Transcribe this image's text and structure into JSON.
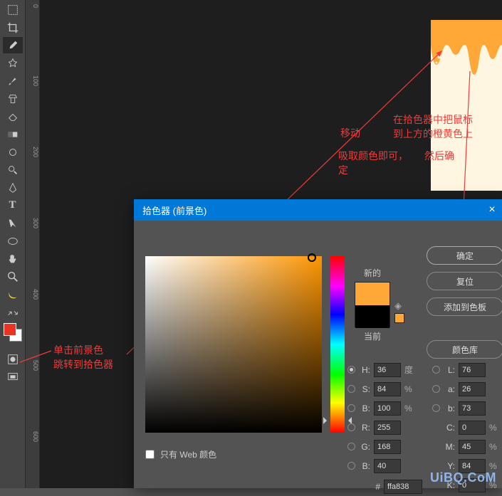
{
  "toolbar_icons": [
    "rect-select",
    "crop",
    "eyedropper",
    "blemish",
    "brush",
    "clone",
    "eraser",
    "paint-bucket",
    "gradient",
    "smudge",
    "dodge",
    "pen",
    "type",
    "path-select",
    "ellipse",
    "hand",
    "zoom",
    "banana"
  ],
  "ruler": {
    "ticks": [
      "0",
      "100",
      "200",
      "300",
      "400",
      "500",
      "600"
    ]
  },
  "annotations": {
    "move": "移动",
    "eyedrop_hint_l1": "吸取颜色即可，",
    "eyedrop_hint_l2": "定",
    "right_hint_l1": "在拾色器中把鼠标",
    "right_hint_l2": "到上方的橙黄色上",
    "right_hint_l3": "然后确",
    "fg_hint_l1": "单击前景色",
    "fg_hint_l2": "跳转到拾色器"
  },
  "dialog": {
    "title": "拾色器 (前景色)",
    "new_label": "新的",
    "current_label": "当前",
    "webonly": "只有 Web 颜色",
    "buttons": {
      "ok": "确定",
      "reset": "复位",
      "add_swatch": "添加到色板",
      "color_lib": "颜色库"
    },
    "fields": {
      "H": {
        "label": "H:",
        "value": "36",
        "unit": "度"
      },
      "S": {
        "label": "S:",
        "value": "84",
        "unit": "%"
      },
      "Bv": {
        "label": "B:",
        "value": "100",
        "unit": "%"
      },
      "R": {
        "label": "R:",
        "value": "255"
      },
      "G": {
        "label": "G:",
        "value": "168"
      },
      "Bb": {
        "label": "B:",
        "value": "40"
      },
      "L": {
        "label": "L:",
        "value": "76"
      },
      "a": {
        "label": "a:",
        "value": "26"
      },
      "b": {
        "label": "b:",
        "value": "73"
      },
      "C": {
        "label": "C:",
        "value": "0",
        "unit": "%"
      },
      "M": {
        "label": "M:",
        "value": "45",
        "unit": "%"
      },
      "Y": {
        "label": "Y:",
        "value": "84",
        "unit": "%"
      },
      "K": {
        "label": "K:",
        "value": "0",
        "unit": "%"
      },
      "hex": {
        "label": "#",
        "value": "ffa838"
      }
    }
  },
  "watermark": "UiBQ.CoM"
}
